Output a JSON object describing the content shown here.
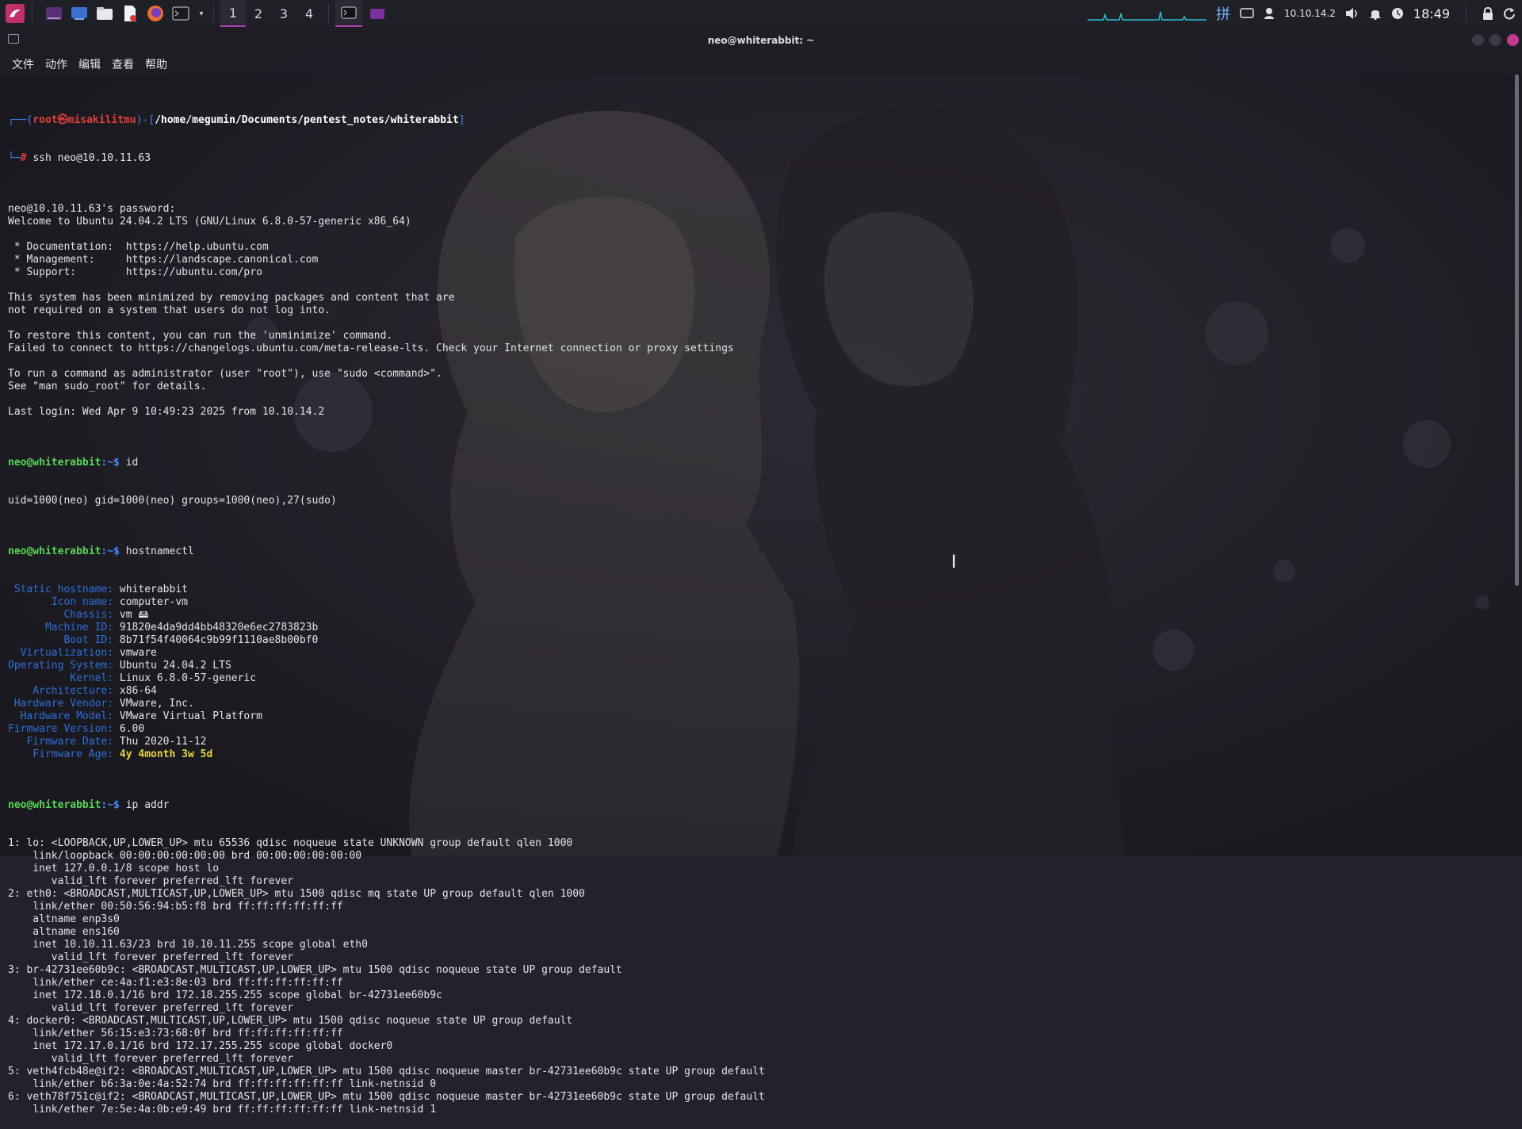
{
  "topbar": {
    "workspaces": [
      "1",
      "2",
      "3",
      "4"
    ],
    "active_workspace": "1",
    "tray": {
      "ip": "10.10.14.2",
      "clock": "18:49",
      "network_icon": "network-icon",
      "volume_icon": "volume-icon",
      "notification_icon": "bell-icon"
    },
    "accent_color": "#b13fb6"
  },
  "window": {
    "title": "neo@whiterabbit: ~",
    "menu": [
      "文件",
      "动作",
      "编辑",
      "查看",
      "帮助"
    ]
  },
  "terminal": {
    "prompt_local": {
      "bracket_open": "┌──(",
      "user": "root㉿misakilitmu",
      "bracket_mid": ")-[",
      "path": "/home/megumin/Documents/pentest_notes/whiterabbit",
      "bracket_close": "]",
      "second": "└─",
      "hash": "#",
      "command": "ssh neo@10.10.11.63"
    },
    "remote_prompt": "neo@whiterabbit",
    "remote_prompt_suffix": ":~$ ",
    "login_lines": [
      "neo@10.10.11.63's password:",
      "Welcome to Ubuntu 24.04.2 LTS (GNU/Linux 6.8.0-57-generic x86_64)",
      "",
      " * Documentation:  https://help.ubuntu.com",
      " * Management:     https://landscape.canonical.com",
      " * Support:        https://ubuntu.com/pro",
      "",
      "This system has been minimized by removing packages and content that are",
      "not required on a system that users do not log into.",
      "",
      "To restore this content, you can run the 'unminimize' command.",
      "Failed to connect to https://changelogs.ubuntu.com/meta-release-lts. Check your Internet connection or proxy settings",
      "",
      "To run a command as administrator (user \"root\"), use \"sudo <command>\".",
      "See \"man sudo_root\" for details.",
      "",
      "Last login: Wed Apr 9 10:49:23 2025 from 10.10.14.2"
    ],
    "cmd_id": "id",
    "id_output": "uid=1000(neo) gid=1000(neo) groups=1000(neo),27(sudo)",
    "cmd_hostnamectl": "hostnamectl",
    "hostnamectl": [
      {
        "key": " Static hostname: ",
        "val": "whiterabbit"
      },
      {
        "key": "       Icon name: ",
        "val": "computer-vm"
      },
      {
        "key": "         Chassis: ",
        "val": "vm 🖴"
      },
      {
        "key": "      Machine ID: ",
        "val": "91820e4da9dd4bb48320e6ec2783823b"
      },
      {
        "key": "         Boot ID: ",
        "val": "8b71f54f40064c9b99f1110ae8b00bf0"
      },
      {
        "key": "  Virtualization: ",
        "val": "vmware"
      },
      {
        "key": "Operating System: ",
        "val": "Ubuntu 24.04.2 LTS"
      },
      {
        "key": "          Kernel: ",
        "val": "Linux 6.8.0-57-generic"
      },
      {
        "key": "    Architecture: ",
        "val": "x86-64"
      },
      {
        "key": " Hardware Vendor: ",
        "val": "VMware, Inc."
      },
      {
        "key": "  Hardware Model: ",
        "val": "VMware Virtual Platform"
      },
      {
        "key": "Firmware Version: ",
        "val": "6.00"
      },
      {
        "key": "   Firmware Date: ",
        "val": "Thu 2020-11-12"
      },
      {
        "key": "    Firmware Age: ",
        "val": "4y 4month 3w 5d"
      }
    ],
    "cmd_ipaddr": "ip addr",
    "ip_lines": [
      "1: lo: <LOOPBACK,UP,LOWER_UP> mtu 65536 qdisc noqueue state UNKNOWN group default qlen 1000",
      "    link/loopback 00:00:00:00:00:00 brd 00:00:00:00:00:00",
      "    inet 127.0.0.1/8 scope host lo",
      "       valid_lft forever preferred_lft forever",
      "2: eth0: <BROADCAST,MULTICAST,UP,LOWER_UP> mtu 1500 qdisc mq state UP group default qlen 1000",
      "    link/ether 00:50:56:94:b5:f8 brd ff:ff:ff:ff:ff:ff",
      "    altname enp3s0",
      "    altname ens160",
      "    inet 10.10.11.63/23 brd 10.10.11.255 scope global eth0",
      "       valid_lft forever preferred_lft forever",
      "3: br-42731ee60b9c: <BROADCAST,MULTICAST,UP,LOWER_UP> mtu 1500 qdisc noqueue state UP group default",
      "    link/ether ce:4a:f1:e3:8e:03 brd ff:ff:ff:ff:ff:ff",
      "    inet 172.18.0.1/16 brd 172.18.255.255 scope global br-42731ee60b9c",
      "       valid_lft forever preferred_lft forever",
      "4: docker0: <BROADCAST,MULTICAST,UP,LOWER_UP> mtu 1500 qdisc noqueue state UP group default",
      "    link/ether 56:15:e3:73:68:0f brd ff:ff:ff:ff:ff:ff",
      "    inet 172.17.0.1/16 brd 172.17.255.255 scope global docker0",
      "       valid_lft forever preferred_lft forever",
      "5: veth4fcb48e@if2: <BROADCAST,MULTICAST,UP,LOWER_UP> mtu 1500 qdisc noqueue master br-42731ee60b9c state UP group default",
      "    link/ether b6:3a:0e:4a:52:74 brd ff:ff:ff:ff:ff:ff link-netnsid 0",
      "6: veth78f751c@if2: <BROADCAST,MULTICAST,UP,LOWER_UP> mtu 1500 qdisc noqueue master br-42731ee60b9c state UP group default",
      "    link/ether 7e:5e:4a:0b:e9:49 brd ff:ff:ff:ff:ff:ff link-netnsid 1"
    ]
  }
}
